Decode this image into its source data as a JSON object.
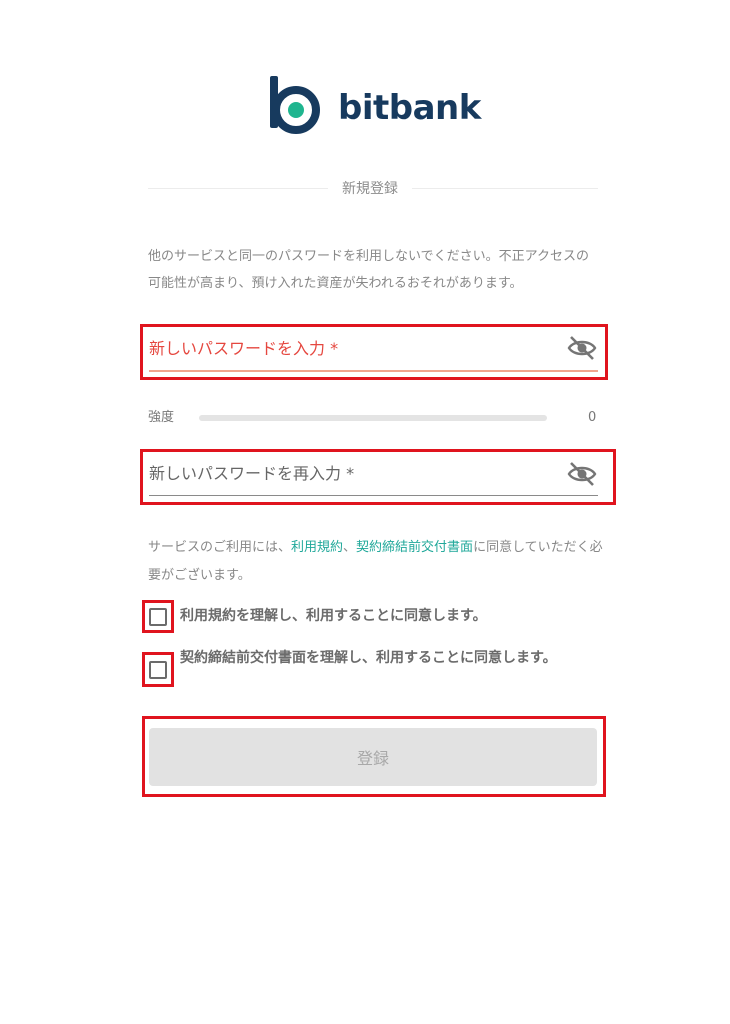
{
  "brand": {
    "name": "bitbank",
    "primary_color": "#173A5E",
    "accent_color": "#1FB58F"
  },
  "section": {
    "title": "新規登録"
  },
  "warning": {
    "text": "他のサービスと同一のパスワードを利用しないでください。不正アクセスの可能性が高まり、預け入れた資産が失われるおそれがあります。"
  },
  "password": {
    "label": "新しいパスワードを入力 *",
    "value": "",
    "toggle_icon": "eye-off-icon"
  },
  "strength": {
    "label": "強度",
    "value": "0",
    "fraction": 0
  },
  "confirm": {
    "label": "新しいパスワードを再入力 *",
    "value": "",
    "toggle_icon": "eye-off-icon"
  },
  "terms": {
    "prefix": "サービスのご利用には、",
    "link1": "利用規約",
    "separator": "、",
    "link2": "契約締結前交付書面",
    "suffix": "に同意していただく必要がございます。"
  },
  "checkboxes": [
    {
      "label": "利用規約を理解し、利用することに同意します。",
      "checked": false
    },
    {
      "label": "契約締結前交付書面を理解し、利用することに同意します。",
      "checked": false
    }
  ],
  "submit": {
    "label": "登録",
    "enabled": false
  },
  "colors": {
    "error_red": "#e5473f",
    "link_teal": "#20a89a",
    "highlight_red": "#e0141e"
  }
}
